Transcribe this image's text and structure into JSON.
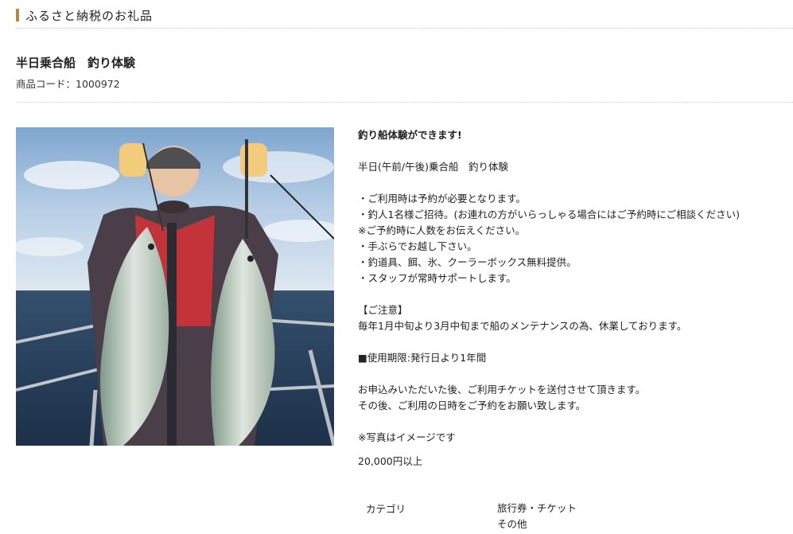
{
  "section": {
    "title": "ふるさと納税のお礼品"
  },
  "product": {
    "title": "半日乗合船　釣り体験",
    "code_label": "商品コード：",
    "code": "1000972",
    "image_alt": "釣り体験の写真"
  },
  "description": {
    "headline": "釣り船体験ができます!",
    "line1": "半日(午前/午後)乗合船　釣り体験",
    "bullets": [
      "・ご利用時は予約が必要となります。",
      "・釣人1名様ご招待。(お連れの方がいらっしゃる場合にはご予約時にご相談ください)",
      "※ご予約時に人数をお伝えください。",
      "・手ぶらでお越し下さい。",
      "・釣道具、餌、氷、クーラーボックス無料提供。",
      "・スタッフが常時サポートします。"
    ],
    "notice_heading": "【ご注意】",
    "notice_text": "毎年1月中旬より3月中旬まで船のメンテナンスの為、休業しております。",
    "validity": "■使用期限:発行日より1年間",
    "after1": "お申込みいただいた後、ご利用チケットを送付させて頂きます。",
    "after2": "その後、ご利用の日時をご予約をお願い致します。",
    "photo_note": "※写真はイメージです"
  },
  "price": "20,000円以上",
  "category": {
    "label": "カテゴリ",
    "values": [
      "旅行券・チケット",
      "その他"
    ]
  },
  "colors": {
    "accent": "#b0893f",
    "divider": "#c8c8c8"
  }
}
